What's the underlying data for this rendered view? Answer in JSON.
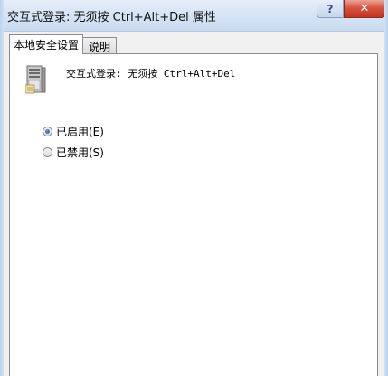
{
  "window": {
    "title": "交互式登录: 无须按 Ctrl+Alt+Del 属性",
    "help_label": "?",
    "close_label": "✕"
  },
  "tabs": [
    {
      "label": "本地安全设置",
      "active": true
    },
    {
      "label": "说明",
      "active": false
    }
  ],
  "policy": {
    "icon": "server-icon",
    "title": "交互式登录: 无须按 Ctrl+Alt+Del"
  },
  "options": [
    {
      "label": "已启用(E)",
      "checked": true
    },
    {
      "label": "已禁用(S)",
      "checked": false
    }
  ]
}
